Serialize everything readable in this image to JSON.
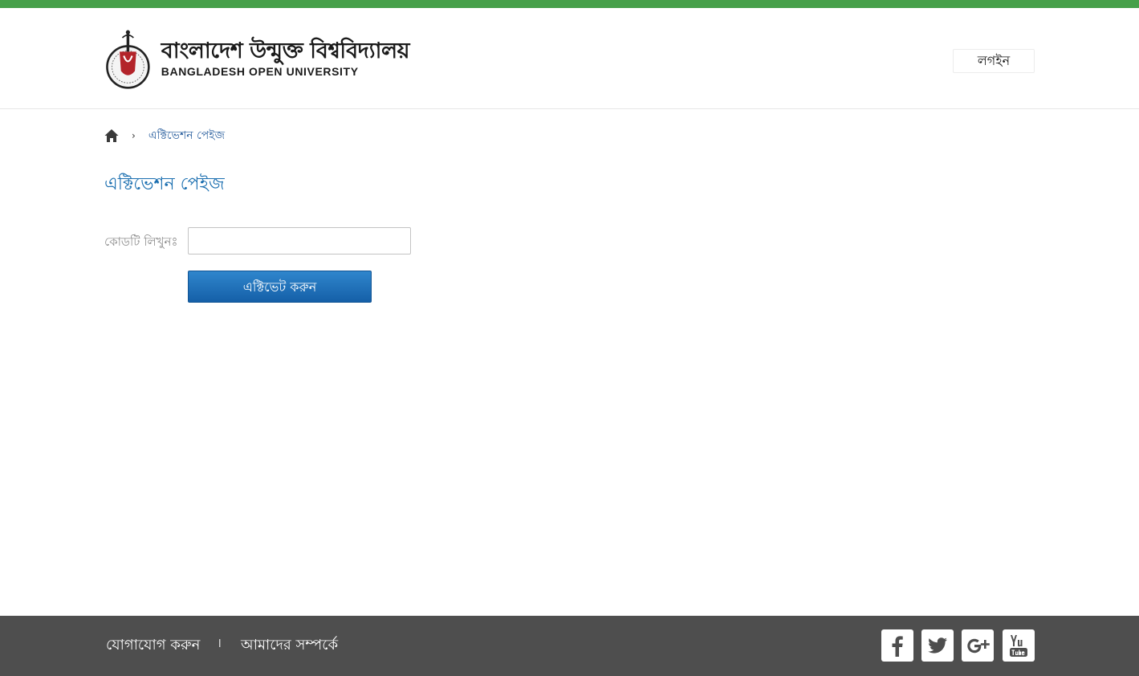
{
  "colors": {
    "top_bar": "#46a04a",
    "accent": "#1b6fb0",
    "button": "#1a6cb8",
    "footer": "#4e4e4e"
  },
  "header": {
    "logo": {
      "icon": "university-emblem-icon",
      "name_bn": "বাংলাদেশ উন্মুক্ত বিশ্ববিদ্যালয়",
      "name_en": "BANGLADESH OPEN UNIVERSITY"
    },
    "login_label": "লগইন"
  },
  "breadcrumb": {
    "home_icon": "home-icon",
    "separator": "›",
    "current": "এক্টিভেশন পেইজ"
  },
  "main": {
    "title": "এক্টিভেশন পেইজ",
    "code_label": "কোডটি লিখুনঃ",
    "code_value": "",
    "activate_label": "এক্টিভেট করুন"
  },
  "footer": {
    "contact_label": "যোগাযোগ করুন",
    "separator": "।",
    "about_label": "আমাদের সম্পর্কে",
    "social": [
      "facebook-icon",
      "twitter-icon",
      "google-plus-icon",
      "youtube-icon"
    ]
  }
}
